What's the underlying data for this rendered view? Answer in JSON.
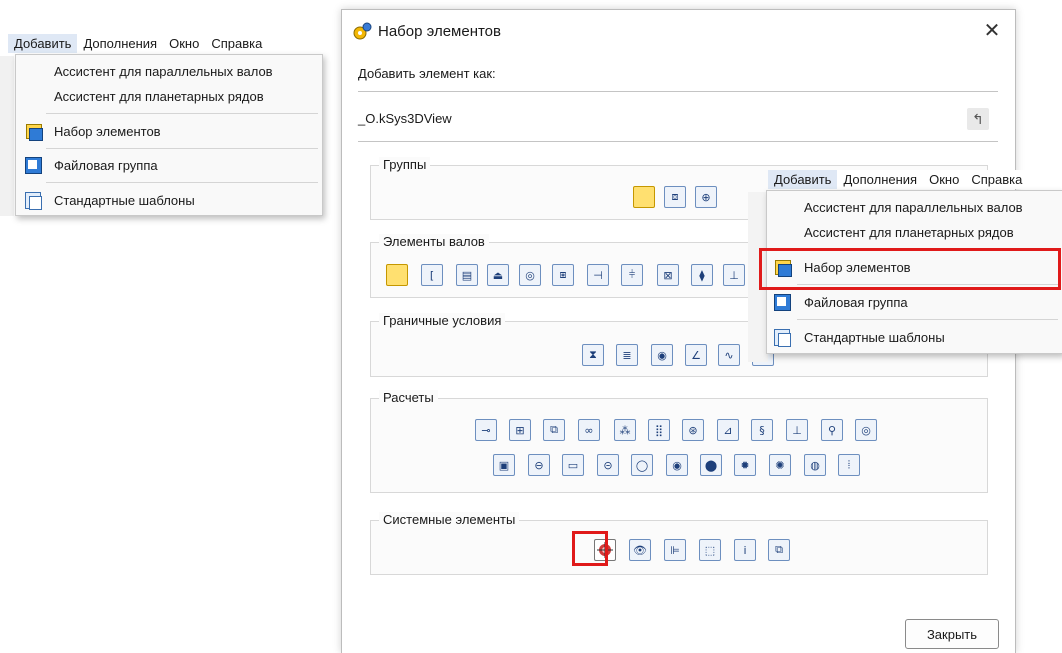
{
  "menu": {
    "items": [
      "Добавить",
      "Дополнения",
      "Окно",
      "Справка"
    ],
    "dropdown": [
      {
        "label": "Ассистент для параллельных валов",
        "icon": ""
      },
      {
        "label": "Ассистент для планетарных рядов",
        "icon": ""
      },
      {
        "label": "Набор элементов",
        "icon": "element-set-icon"
      },
      {
        "label": "Файловая группа",
        "icon": "file-group-icon"
      },
      {
        "label": "Стандартные шаблоны",
        "icon": "templates-icon"
      }
    ]
  },
  "dialog": {
    "title": "Набор элементов",
    "close_glyph": "✕",
    "add_as_label": "Добавить элемент как:",
    "target": "_O.kSys3DView",
    "groups": {
      "groups": "Группы",
      "shaft": "Элементы валов",
      "boundary": "Граничные условия",
      "calc": "Расчеты",
      "system": "Системные элементы"
    },
    "close_button": "Закрыть"
  },
  "colors": {
    "highlight": "#e01a1a",
    "accent": "#2f7bd6",
    "yellow": "#ffd54a"
  }
}
